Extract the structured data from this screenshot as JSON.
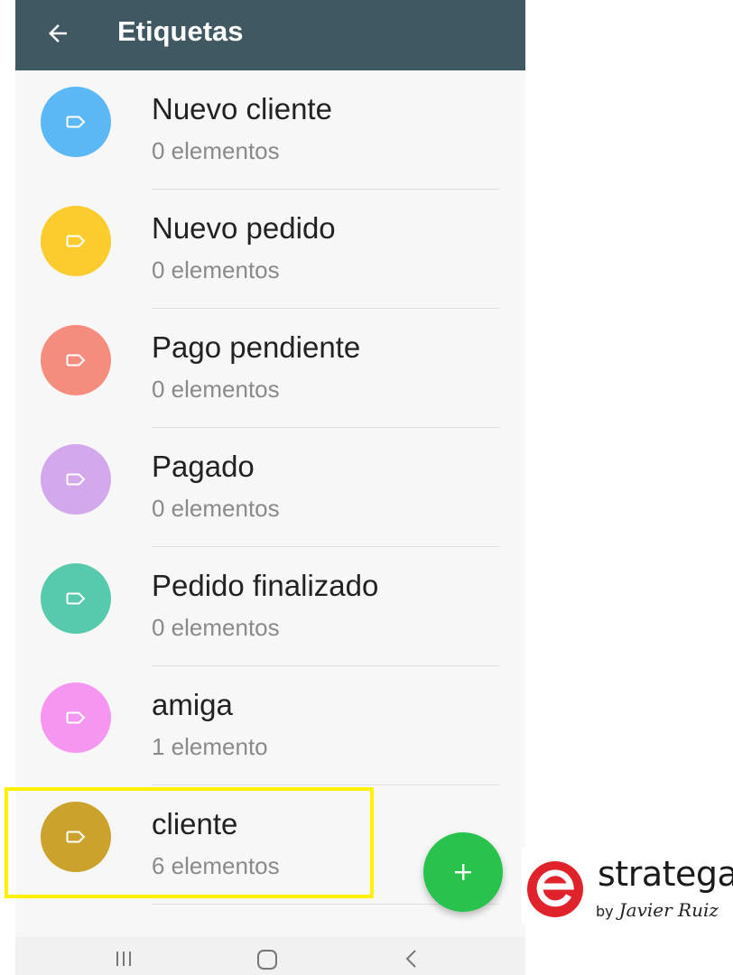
{
  "header": {
    "title": "Etiquetas",
    "back_icon": "arrow-left-icon"
  },
  "labels": [
    {
      "name": "Nuevo cliente",
      "count": "0 elementos",
      "color": "#5bb8f5"
    },
    {
      "name": "Nuevo pedido",
      "count": "0 elementos",
      "color": "#fccc2f"
    },
    {
      "name": "Pago pendiente",
      "count": "0 elementos",
      "color": "#f58d7e"
    },
    {
      "name": "Pagado",
      "count": "0 elementos",
      "color": "#d3a8ec"
    },
    {
      "name": "Pedido finalizado",
      "count": "0 elementos",
      "color": "#57c9ac"
    },
    {
      "name": "amiga",
      "count": "1 elemento",
      "color": "#f596f0"
    },
    {
      "name": "cliente",
      "count": "6 elementos",
      "color": "#cba22c"
    }
  ],
  "highlighted_label_index": 6,
  "fab": {
    "icon": "plus-icon",
    "color": "#27c34d"
  },
  "navbar": {
    "icons": [
      "recent-apps-icon",
      "home-icon",
      "back-icon"
    ]
  },
  "watermark": {
    "brand": "stratega",
    "byline_prefix": "by",
    "byline_name": "Javier Ruiz",
    "logo_color": "#e0232a"
  }
}
